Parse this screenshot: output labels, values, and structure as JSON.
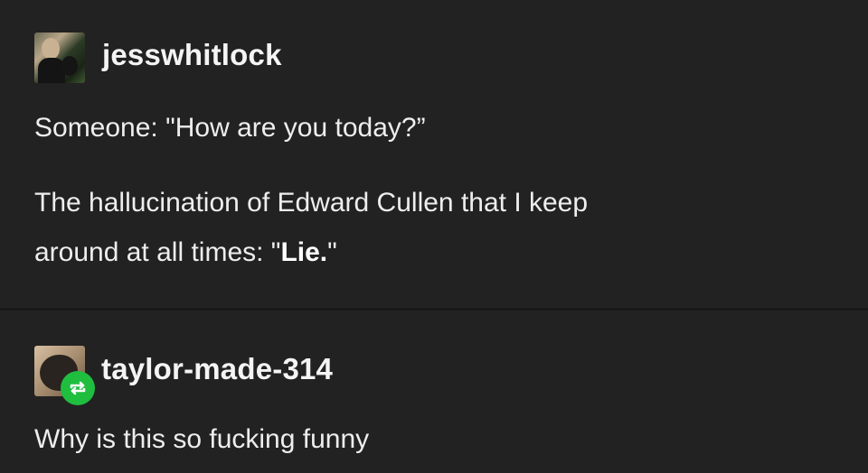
{
  "posts": [
    {
      "username": "jesswhitlock",
      "avatar_icon": "user-avatar",
      "paragraphs": [
        {
          "text": "Someone: \"How are you today?”"
        },
        {
          "line1": "The hallucination of Edward Cullen that I keep",
          "line2_prefix": "around at all times: \"",
          "line2_bold": "Lie.",
          "line2_suffix": "\""
        }
      ]
    },
    {
      "username": "taylor-made-314",
      "avatar_icon": "user-avatar",
      "badge_icon": "reblog-icon",
      "badge_color": "#1fbe3f",
      "text": "Why is this so fucking funny"
    }
  ],
  "colors": {
    "background": "#222222",
    "text": "#eeeeee",
    "divider": "#191919"
  }
}
